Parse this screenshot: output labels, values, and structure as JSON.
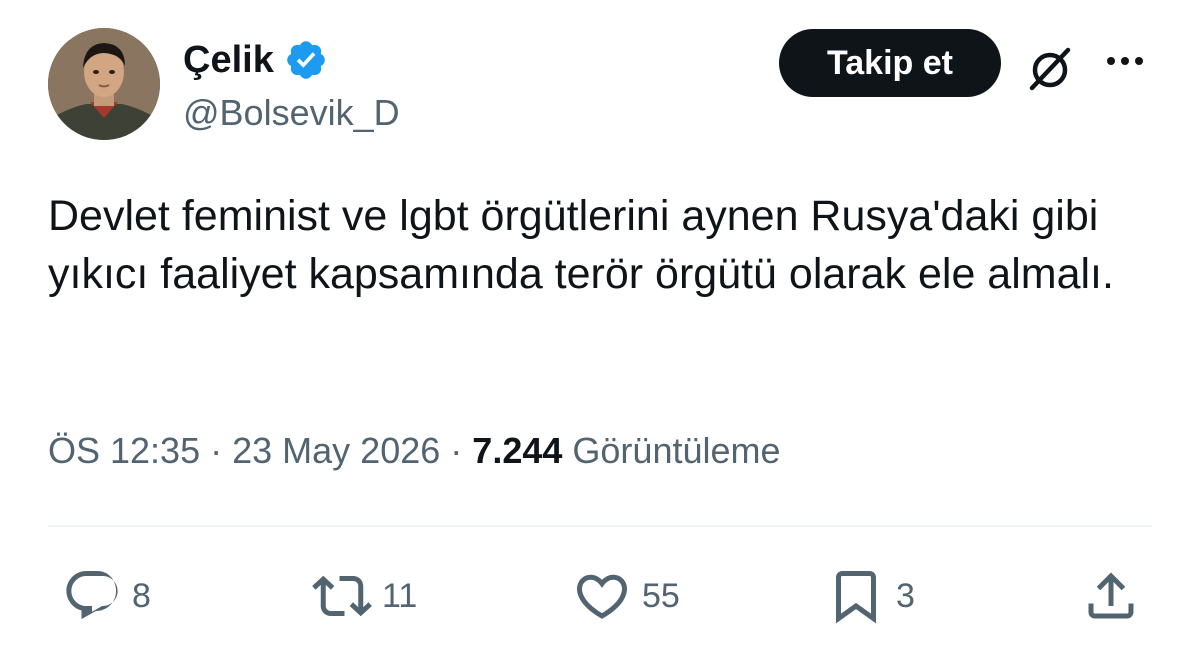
{
  "user": {
    "name": "Çelik",
    "handle": "@Bolsevik_D",
    "avatar_icon": "portrait-avatar",
    "verified_color": "#1d9bf0"
  },
  "header": {
    "follow_label": "Takip et",
    "grok_icon": "grok-icon",
    "more_icon": "ellipsis-icon"
  },
  "tweet": {
    "text": "Devlet feminist ve lgbt örgütlerini aynen Rusya'daki gibi yıkıcı faaliyet kapsamında terör örgütü olarak ele almalı."
  },
  "meta": {
    "time": "ÖS 12:35",
    "date": "23 May 2026",
    "views_count": "7.244",
    "views_label": "Görüntüleme"
  },
  "actions": {
    "replies": "8",
    "retweets": "11",
    "likes": "55",
    "bookmarks": "3"
  },
  "colors": {
    "text": "#0f1419",
    "secondary": "#536471",
    "divider": "#eff3f4",
    "button": "#0f1419"
  }
}
